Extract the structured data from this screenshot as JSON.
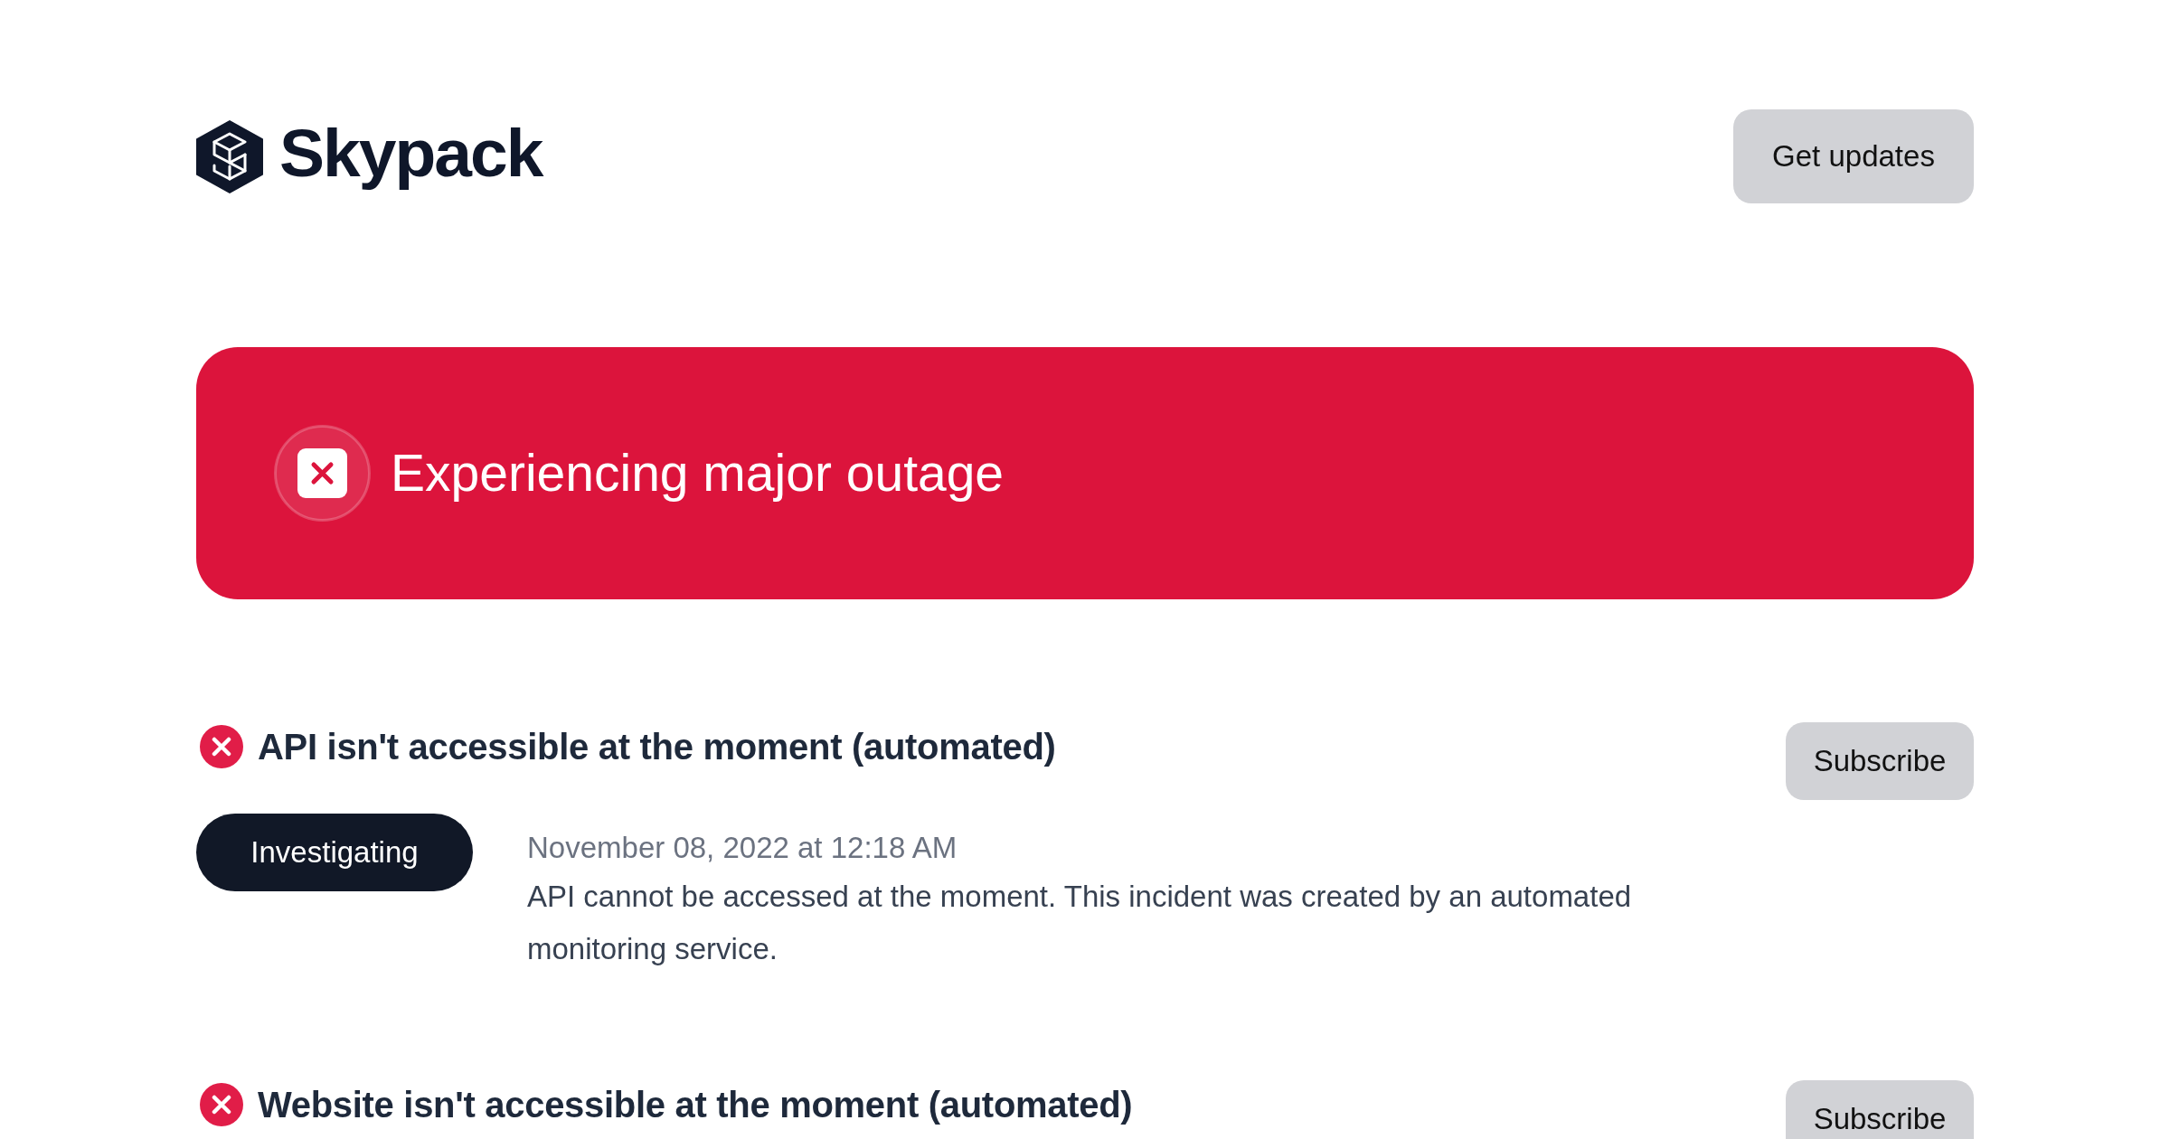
{
  "header": {
    "logo_text": "Skypack",
    "button": "Get updates"
  },
  "banner": {
    "text": "Experiencing major outage"
  },
  "incidents": [
    {
      "title": "API isn't accessible at the moment (automated)",
      "button": "Subscribe",
      "updates": [
        {
          "status": "Investigating",
          "time": "November 08, 2022 at 12:18 AM",
          "message": "API cannot be accessed at the moment. This incident was created by an automated monitoring service."
        }
      ]
    },
    {
      "title": "Website isn't accessible at the moment (automated)",
      "button": "Subscribe"
    }
  ]
}
